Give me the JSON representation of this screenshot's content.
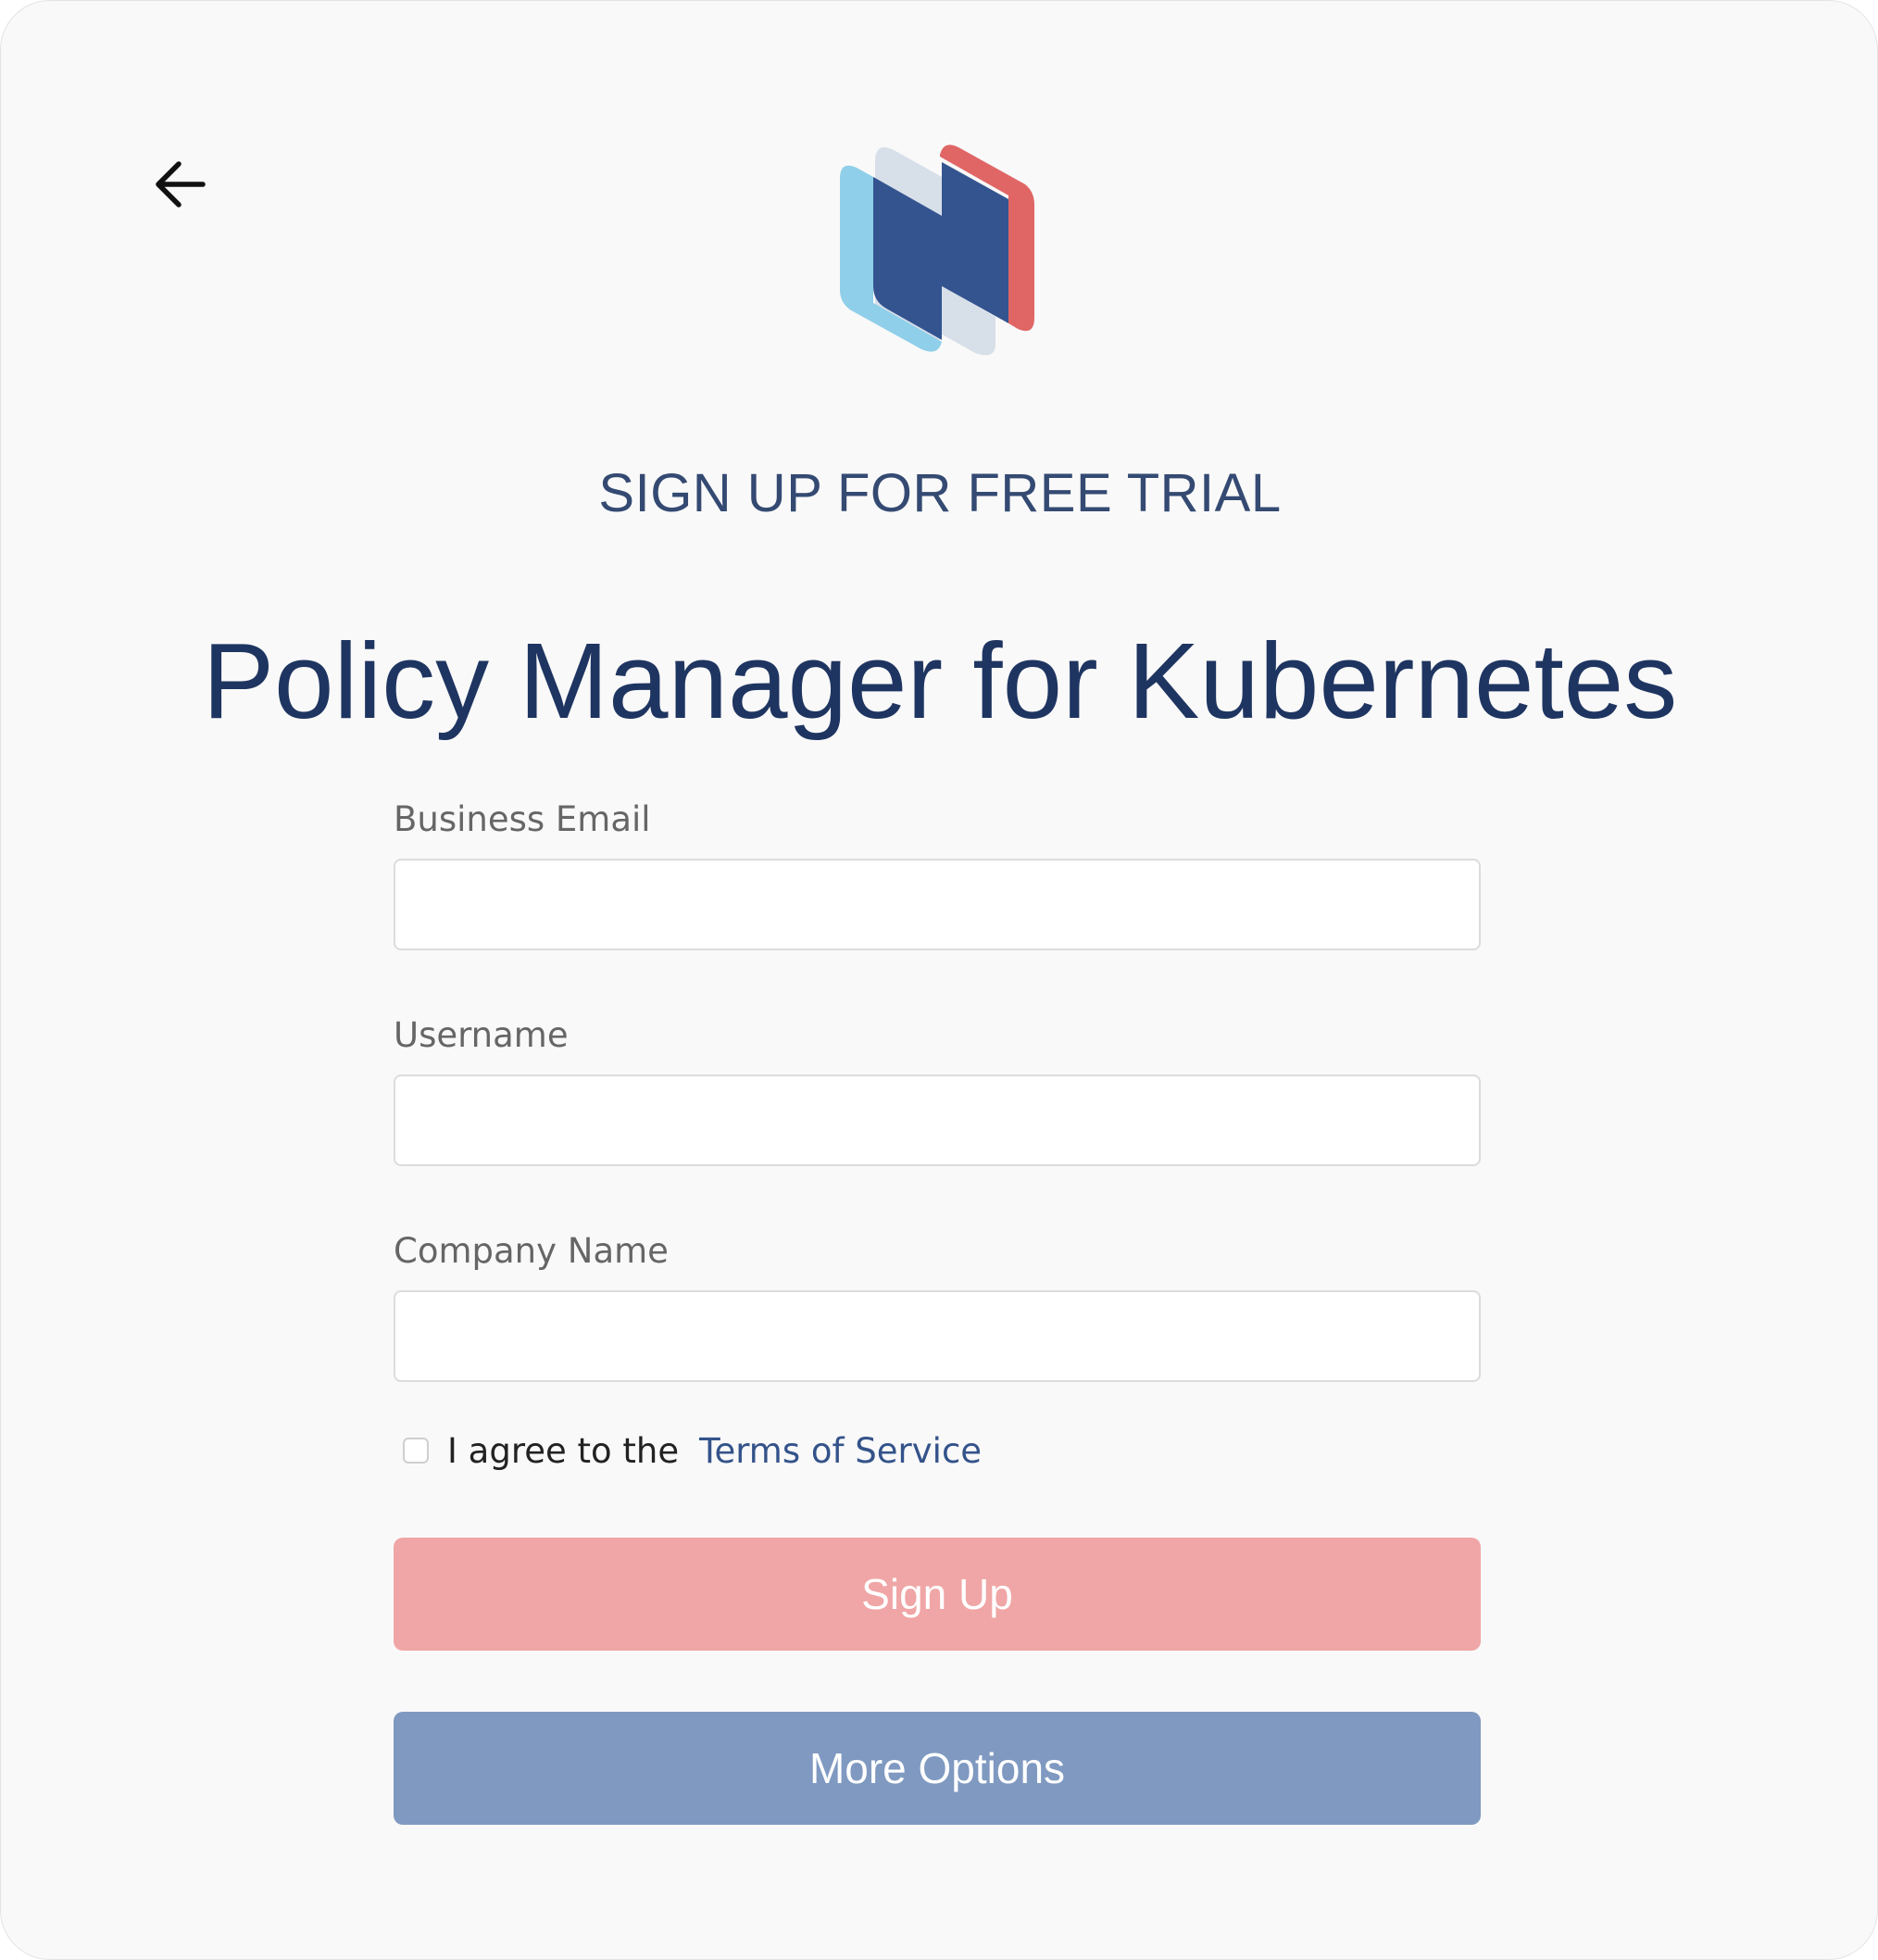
{
  "header": {
    "back_icon": "arrow-left-icon",
    "logo_icon": "brand-logo-icon",
    "eyebrow": "SIGN UP FOR FREE TRIAL",
    "title": "Policy Manager for Kubernetes"
  },
  "form": {
    "email_label": "Business Email",
    "email_value": "",
    "username_label": "Username",
    "username_value": "",
    "company_label": "Company Name",
    "company_value": "",
    "agree_text": "I agree to the",
    "terms_link": "Terms of Service",
    "agree_checked": false
  },
  "buttons": {
    "signup_label": "Sign Up",
    "more_label": "More Options"
  },
  "colors": {
    "logo_light_blue": "#8fcfe9",
    "logo_gray": "#d7dfe9",
    "logo_navy": "#33548f",
    "logo_red": "#e06666",
    "signup_button": "#f0a6a6",
    "more_button": "#7f99c1",
    "heading": "#1f3561"
  }
}
